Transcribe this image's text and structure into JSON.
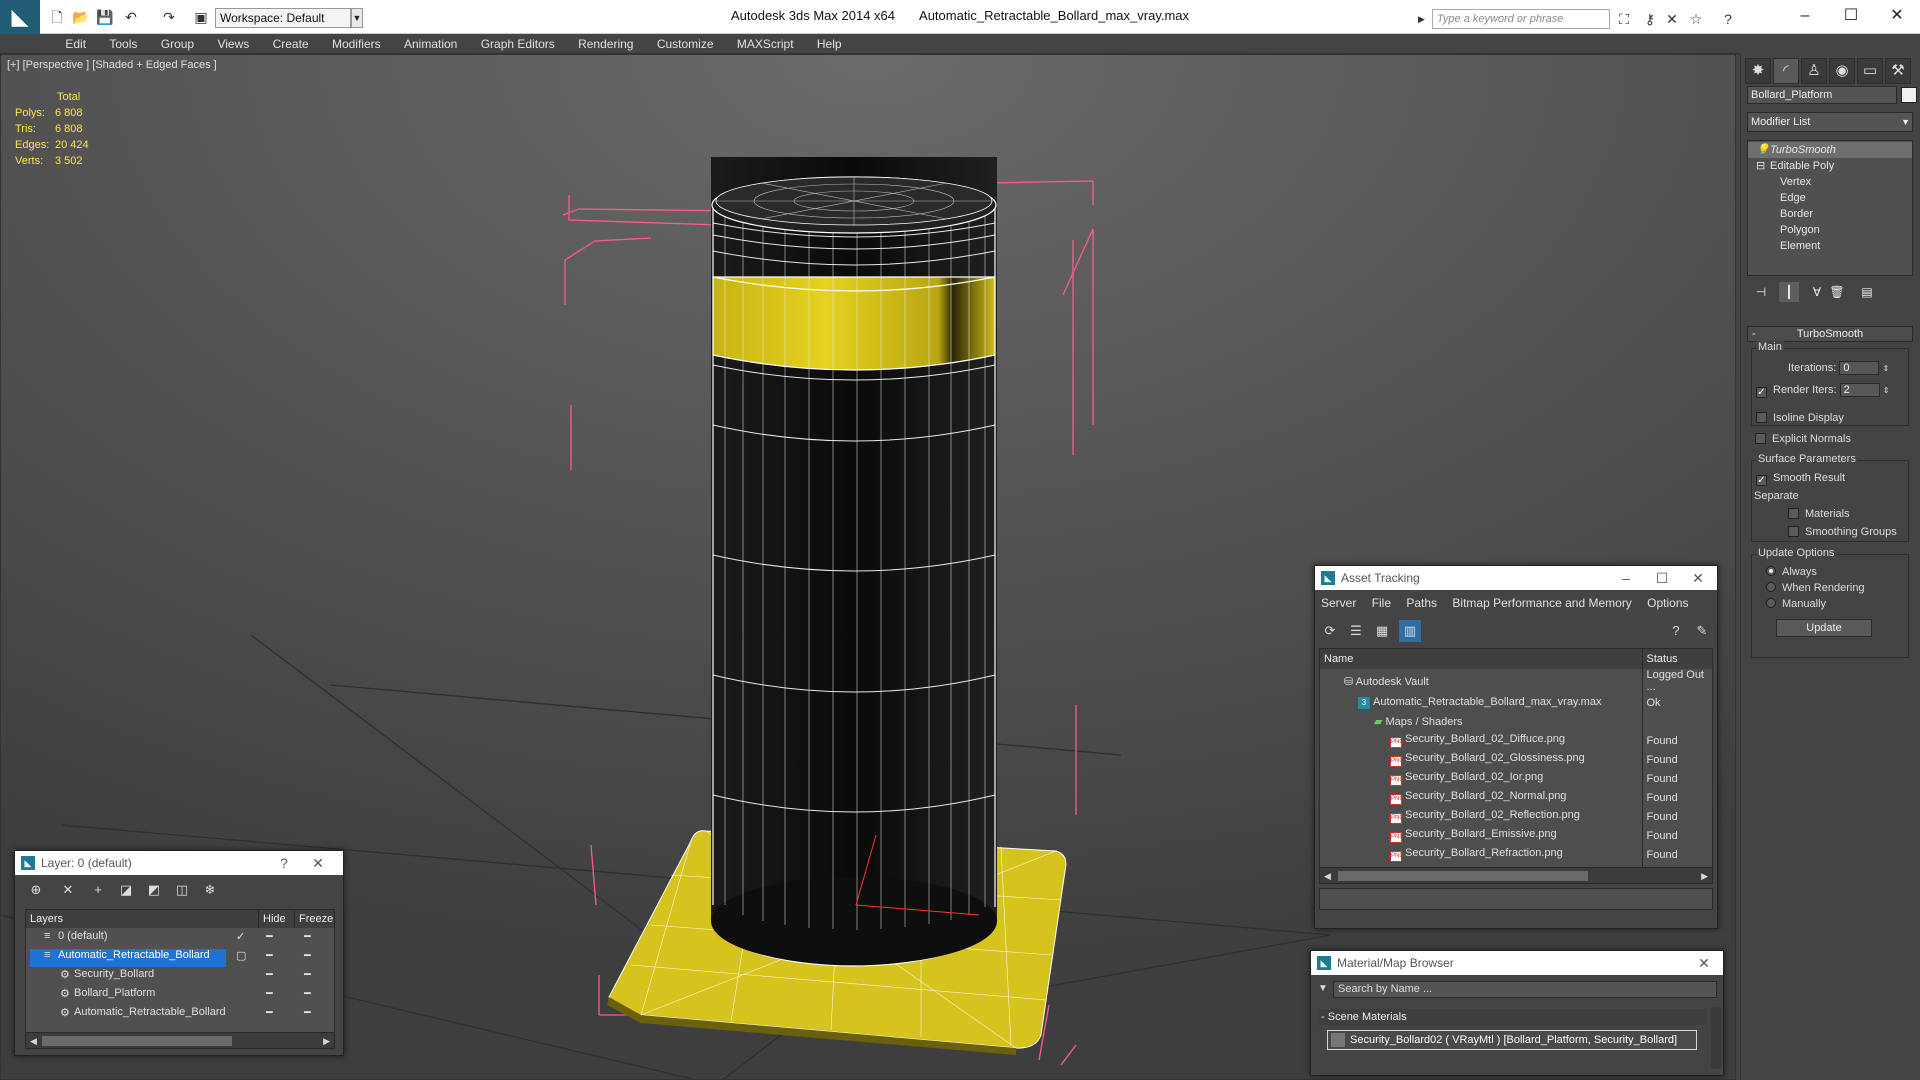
{
  "titlebar": {
    "workspace": "Workspace: Default",
    "app": "Autodesk 3ds Max  2014 x64",
    "file": "Automatic_Retractable_Bollard_max_vray.max",
    "search_placeholder": "Type a keyword or phrase"
  },
  "menu": [
    "Edit",
    "Tools",
    "Group",
    "Views",
    "Create",
    "Modifiers",
    "Animation",
    "Graph Editors",
    "Rendering",
    "Customize",
    "MAXScript",
    "Help"
  ],
  "viewport": {
    "label": "[+] [Perspective ] [Shaded + Edged Faces ]",
    "stats_header": "Total",
    "stats": [
      {
        "label": "Polys:",
        "value": "6 808"
      },
      {
        "label": "Tris:",
        "value": "6 808"
      },
      {
        "label": "Edges:",
        "value": "20 424"
      },
      {
        "label": "Verts:",
        "value": "3 502"
      }
    ],
    "colors": {
      "bg": "#5b5b5b",
      "bollard": "#111111",
      "band": "#e6d21f",
      "base": "#e0cc22",
      "wire": "#ffffff",
      "bbox": "#ff5a8a"
    }
  },
  "cmd": {
    "object_name": "Bollard_Platform",
    "modifier_list": "Modifier List",
    "stack": [
      {
        "label": "TurboSmooth",
        "indent": 0,
        "sel": true
      },
      {
        "label": "Editable Poly",
        "indent": 0,
        "sel": false
      },
      {
        "label": "Vertex",
        "indent": 1,
        "sel": false
      },
      {
        "label": "Edge",
        "indent": 1,
        "sel": false
      },
      {
        "label": "Border",
        "indent": 1,
        "sel": false
      },
      {
        "label": "Polygon",
        "indent": 1,
        "sel": false
      },
      {
        "label": "Element",
        "indent": 1,
        "sel": false
      }
    ],
    "rollout": "TurboSmooth",
    "main": "Main",
    "iterations_label": "Iterations:",
    "iterations": "0",
    "render_iters_label": "Render Iters:",
    "render_iters": "2",
    "isoline": "Isoline Display",
    "explicit_normals": "Explicit Normals",
    "surface_params": "Surface Parameters",
    "smooth_result": "Smooth Result",
    "separate": "Separate",
    "materials": "Materials",
    "smoothing_groups": "Smoothing Groups",
    "update_options": "Update Options",
    "always": "Always",
    "when_rendering": "When Rendering",
    "manually": "Manually",
    "update_btn": "Update"
  },
  "asset": {
    "title": "Asset Tracking",
    "menu": [
      "Server",
      "File",
      "Paths",
      "Bitmap Performance and Memory",
      "Options"
    ],
    "col_name": "Name",
    "col_status": "Status",
    "rows": [
      {
        "name": "Autodesk Vault",
        "status": "Logged Out ...",
        "level": 1,
        "icon": "vault"
      },
      {
        "name": "Automatic_Retractable_Bollard_max_vray.max",
        "status": "Ok",
        "level": 2,
        "icon": "max"
      },
      {
        "name": "Maps / Shaders",
        "status": "",
        "level": 3,
        "icon": "maps"
      },
      {
        "name": "Security_Bollard_02_Diffuce.png",
        "status": "Found",
        "level": 4,
        "icon": "png"
      },
      {
        "name": "Security_Bollard_02_Glossiness.png",
        "status": "Found",
        "level": 4,
        "icon": "png"
      },
      {
        "name": "Security_Bollard_02_Ior.png",
        "status": "Found",
        "level": 4,
        "icon": "png"
      },
      {
        "name": "Security_Bollard_02_Normal.png",
        "status": "Found",
        "level": 4,
        "icon": "png"
      },
      {
        "name": "Security_Bollard_02_Reflection.png",
        "status": "Found",
        "level": 4,
        "icon": "png"
      },
      {
        "name": "Security_Bollard_Emissive.png",
        "status": "Found",
        "level": 4,
        "icon": "png"
      },
      {
        "name": "Security_Bollard_Refraction.png",
        "status": "Found",
        "level": 4,
        "icon": "png"
      }
    ]
  },
  "layers": {
    "title": "Layer: 0 (default)",
    "col_layers": "Layers",
    "col_hide": "Hide",
    "col_freeze": "Freeze",
    "rows": [
      {
        "name": "0 (default)",
        "level": 0,
        "sel": false,
        "check": true
      },
      {
        "name": "Automatic_Retractable_Bollard",
        "level": 0,
        "sel": true,
        "check": false
      },
      {
        "name": "Security_Bollard",
        "level": 1,
        "sel": false,
        "check": false
      },
      {
        "name": "Bollard_Platform",
        "level": 1,
        "sel": false,
        "check": false
      },
      {
        "name": "Automatic_Retractable_Bollard",
        "level": 1,
        "sel": false,
        "check": false
      }
    ]
  },
  "matbrowser": {
    "title": "Material/Map Browser",
    "search_placeholder": "Search by Name ...",
    "section": "Scene Materials",
    "item": "Security_Bollard02  ( VRayMtl )  [Bollard_Platform, Security_Bollard]"
  }
}
